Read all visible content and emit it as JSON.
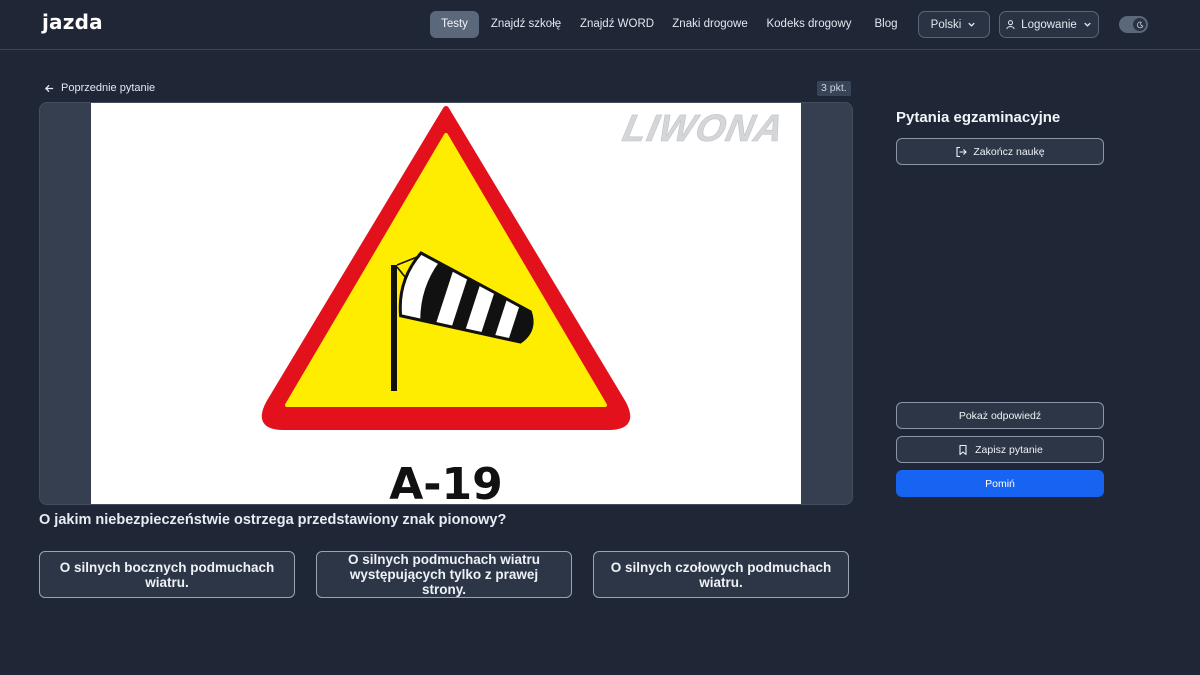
{
  "header": {
    "logo": "jazda",
    "nav": [
      {
        "label": "Testy",
        "active": true
      },
      {
        "label": "Znajdź szkołę"
      },
      {
        "label": "Znajdź WORD"
      },
      {
        "label": "Znaki drogowe"
      },
      {
        "label": "Kodeks drogowy"
      },
      {
        "label": "Blog"
      }
    ],
    "language": "Polski",
    "login": "Logowanie",
    "theme_toggle_icon": "moon-icon"
  },
  "question": {
    "prev_label": "Poprzednie pytanie",
    "points": "3 pkt.",
    "image": {
      "watermark": "LIWONA",
      "sign_code": "A-19"
    },
    "text": "O jakim niebezpieczeństwie ostrzega przedstawiony znak pionowy?",
    "answers": [
      "O silnych bocznych podmuchach wiatru.",
      "O silnych podmuchach wiatru występujących tylko z prawej strony.",
      "O silnych czołowych podmuchach wiatru."
    ]
  },
  "sidebar": {
    "title": "Pytania egzaminacyjne",
    "finish_label": "Zakończ naukę",
    "show_answer_label": "Pokaż odpowiedź",
    "save_label": "Zapisz pytanie",
    "skip_label": "Pomiń"
  },
  "colors": {
    "background": "#1f2636",
    "primary": "#1763f2",
    "sign_red": "#e3111b",
    "sign_yellow": "#ffed00"
  }
}
